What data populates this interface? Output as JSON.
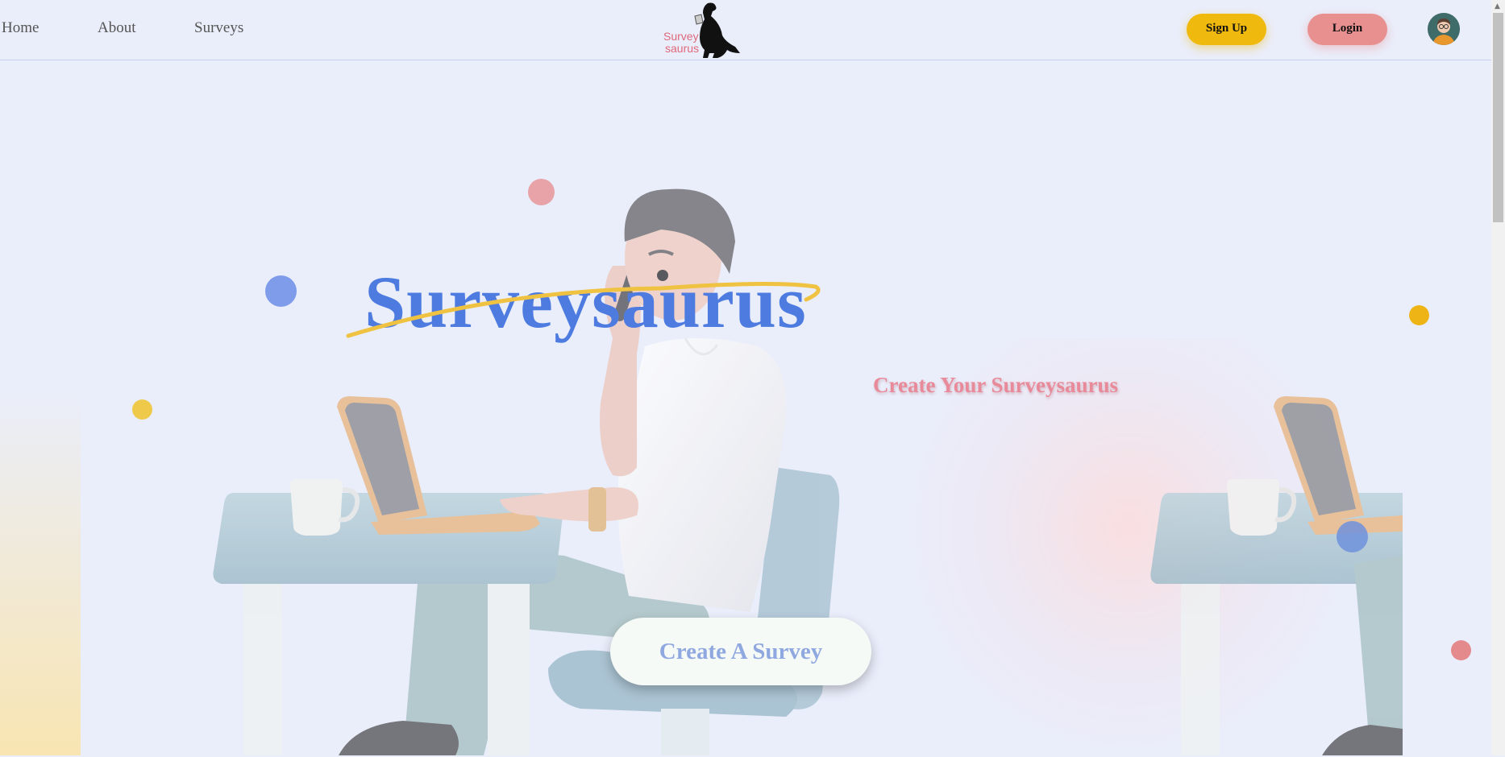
{
  "nav": {
    "links": [
      "Home",
      "About",
      "Surveys"
    ],
    "logo_text_line1": "Survey",
    "logo_text_line2": "saurus",
    "signup_label": "Sign Up",
    "login_label": "Login"
  },
  "hero": {
    "title": "Surveysaurus",
    "subtitle": "Create Your Surveysaurus",
    "cta_label": "Create A Survey"
  },
  "colors": {
    "primary_blue": "#4d7be0",
    "accent_yellow": "#f0b90e",
    "accent_pink": "#e89090",
    "background": "#eaeefb"
  },
  "icons": [
    "dinosaur-logo-icon",
    "user-avatar-icon",
    "scroll-up-arrow-icon"
  ]
}
